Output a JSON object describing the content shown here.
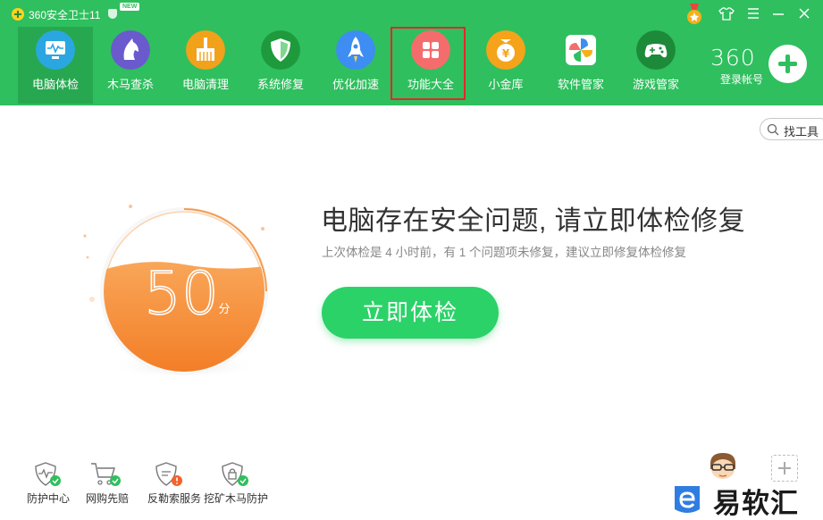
{
  "app": {
    "title": "360安全卫士11",
    "new_badge": "NEW"
  },
  "nav": [
    {
      "id": "checkup",
      "label": "电脑体检",
      "icon": "monitor-icon",
      "color": "#2aa7e0",
      "active": true
    },
    {
      "id": "trojan",
      "label": "木马查杀",
      "icon": "horse-icon",
      "color": "#6a5acd"
    },
    {
      "id": "cleanup",
      "label": "电脑清理",
      "icon": "broom-icon",
      "color": "#f2a11a"
    },
    {
      "id": "repair",
      "label": "系统修复",
      "icon": "shield-icon",
      "color": "#1e9a3c"
    },
    {
      "id": "speedup",
      "label": "优化加速",
      "icon": "rocket-icon",
      "color": "#3d8df2"
    },
    {
      "id": "toolbox",
      "label": "功能大全",
      "icon": "grid-icon",
      "color": "#f46c6c"
    },
    {
      "id": "vault",
      "label": "小金库",
      "icon": "coin-icon",
      "color": "#f5a31a"
    },
    {
      "id": "software",
      "label": "软件管家",
      "icon": "pinwheel-icon",
      "color": "#ffffff"
    },
    {
      "id": "games",
      "label": "游戏管家",
      "icon": "gamepad-icon",
      "color": "#1d8a3a"
    }
  ],
  "login": {
    "brand": "360",
    "label": "登录帐号"
  },
  "search": {
    "label": "找工具"
  },
  "score": {
    "value": "50",
    "unit": "分",
    "level": 0.5
  },
  "status": {
    "headline": "电脑存在安全问题, 请立即体检修复",
    "subline": "上次体检是 4 小时前，有 1 个问题项未修复，建议立即修复体检修复"
  },
  "primary_button": "立即体检",
  "bottom": [
    {
      "label": "防护中心",
      "icon": "shield-heartbeat-icon"
    },
    {
      "label": "网购先赔",
      "icon": "cart-check-icon"
    },
    {
      "label": "反勒索服务",
      "icon": "shield-alert-icon"
    },
    {
      "label": "挖矿木马防护",
      "icon": "shield-lock-icon"
    }
  ],
  "watermark": "易软汇",
  "colors": {
    "brand_green": "#2fbf5e",
    "button_green": "#2bd268",
    "gauge_orange": "#f68a2e"
  }
}
